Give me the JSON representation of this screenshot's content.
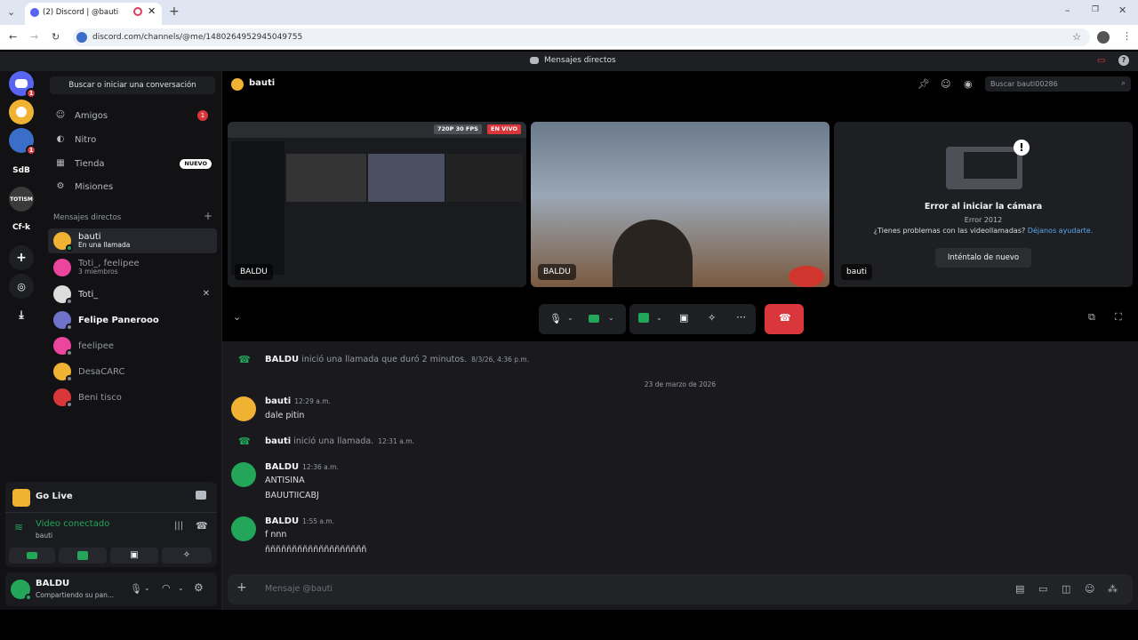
{
  "browser": {
    "tab_title": "(2) Discord | @bauti",
    "url": "discord.com/channels/@me/1480264952945049755"
  },
  "topstrip": {
    "title": "Mensajes directos"
  },
  "guilds": [
    {
      "label": "",
      "badge": "1",
      "color": "#5865f2"
    },
    {
      "label": "",
      "badge": "",
      "color": "#f0b232"
    },
    {
      "label": "",
      "badge": "1",
      "color": "#3a6ec8"
    },
    {
      "label": "SdB",
      "badge": "",
      "color": "#121214"
    },
    {
      "label": "TOTISM",
      "badge": "",
      "color": "#3a3a3a"
    },
    {
      "label": "Cf-k",
      "badge": "",
      "color": "#121214"
    }
  ],
  "sidebar": {
    "search_label": "Buscar o iniciar una conversación",
    "nav": [
      {
        "label": "Amigos",
        "icon": "friends-icon",
        "badge": "1"
      },
      {
        "label": "Nitro",
        "icon": "nitro-icon",
        "badge": ""
      },
      {
        "label": "Tienda",
        "icon": "shop-icon",
        "badge": "NUEVO"
      },
      {
        "label": "Misiones",
        "icon": "quests-icon",
        "badge": ""
      }
    ],
    "dm_header": "Mensajes directos",
    "dms": [
      {
        "name": "bauti",
        "sub": "En una llamada",
        "color": "#f0b232"
      },
      {
        "name": "Toti_, feelipee",
        "sub": "3 miembros",
        "color": "#eb459e"
      },
      {
        "name": "Toti_",
        "sub": "",
        "color": "#dddddd"
      },
      {
        "name": "Felipe Panerooo",
        "sub": "",
        "color": "#6f72c9"
      },
      {
        "name": "feelipee",
        "sub": "",
        "color": "#eb459e"
      },
      {
        "name": "DesaCARC",
        "sub": "",
        "color": "#f0b232"
      },
      {
        "name": "Beni tisco",
        "sub": "",
        "color": "#da373c"
      }
    ]
  },
  "voice": {
    "golive": "Go Live",
    "status": "Video conectado",
    "channel": "bauti"
  },
  "user": {
    "name": "BALDU",
    "status": "Compartiendo su pan..."
  },
  "header": {
    "channel": "bauti",
    "search_placeholder": "Buscar bauti00286"
  },
  "call": {
    "tiles": [
      {
        "label": "BALDU",
        "badge_quality": "720P 30 FPS",
        "badge_live": "EN VIVO"
      },
      {
        "label": "BALDU"
      },
      {
        "label": "bauti",
        "error_title": "Error al iniciar la cámara",
        "error_code": "Error 2012",
        "help_text": "¿Tienes problemas con las videollamadas?",
        "help_link": "Déjanos ayudarte.",
        "retry": "Inténtalo de nuevo"
      }
    ]
  },
  "messages": {
    "call1": {
      "name": "BALDU",
      "text": "inició una llamada que duró 2 minutos.",
      "time": "8/3/26, 4:36 p.m."
    },
    "date_divider": "23 de marzo de 2026",
    "m1": {
      "name": "bauti",
      "time": "12:29 a.m.",
      "lines": [
        "dale pitin"
      ]
    },
    "call2": {
      "name": "bauti",
      "text": "inició una llamada.",
      "time": "12:31 a.m."
    },
    "m2": {
      "name": "BALDU",
      "time": "12:36 a.m.",
      "lines": [
        "ANTISINA",
        "BAUUTIICABJ"
      ]
    },
    "m3": {
      "name": "BALDU",
      "time": "1:55 a.m.",
      "lines": [
        "f nnn",
        "ñññññññññññññññññññ"
      ]
    }
  },
  "composer": {
    "placeholder": "Mensaje @bauti"
  },
  "colors": {
    "accent": "#5865f2",
    "green": "#23a55a",
    "red": "#da373c"
  }
}
